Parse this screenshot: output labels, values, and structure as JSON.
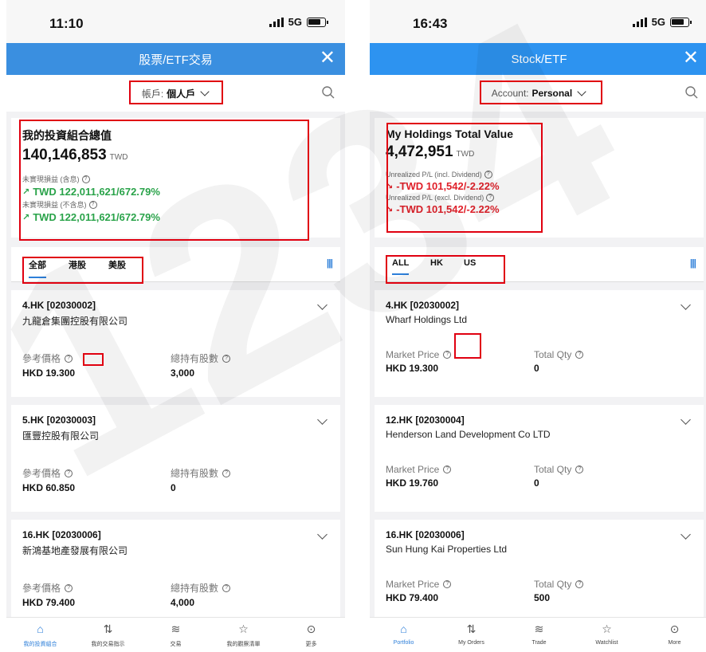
{
  "left": {
    "status": {
      "time": "11:10",
      "network": "5G"
    },
    "header": {
      "title": "股票/ETF交易",
      "close": "✕"
    },
    "account": {
      "label": "帳戶:",
      "value": "個人戶"
    },
    "summary": {
      "title": "我的投資組合總值",
      "value": "140,146,853",
      "currency": "TWD",
      "pl1_label": "未實現損益 (含息)",
      "pl1_value": "TWD 122,011,621/672.79%",
      "pl2_label": "未實現損益 (不含息)",
      "pl2_value": "TWD 122,011,621/672.79%"
    },
    "tabs": [
      "全部",
      "港股",
      "美股"
    ],
    "holdings": [
      {
        "code": "4.HK [02030002]",
        "name": "九龍倉集團控股有限公司",
        "price_label": "參考價格",
        "price": "HKD 19.300",
        "qty_label": "總持有股數",
        "qty": "3,000"
      },
      {
        "code": "5.HK [02030003]",
        "name": "匯豐控股有限公司",
        "price_label": "參考價格",
        "price": "HKD 60.850",
        "qty_label": "總持有股數",
        "qty": "0"
      },
      {
        "code": "16.HK [02030006]",
        "name": "新鴻基地產發展有限公司",
        "price_label": "參考價格",
        "price": "HKD 79.400",
        "qty_label": "總持有股數",
        "qty": "4,000"
      }
    ],
    "nav": [
      "我的投資組合",
      "我的交易指示",
      "交易",
      "我的觀察清單",
      "更多"
    ]
  },
  "right": {
    "status": {
      "time": "16:43",
      "network": "5G"
    },
    "header": {
      "title": "Stock/ETF",
      "close": "✕"
    },
    "account": {
      "label": "Account:",
      "value": "Personal"
    },
    "summary": {
      "title": "My Holdings Total Value",
      "value": "4,472,951",
      "currency": "TWD",
      "pl1_label": "Unrealized P/L (incl. Dividend)",
      "pl1_value": "-TWD 101,542/-2.22%",
      "pl2_label": "Unrealized P/L (excl. Dividend)",
      "pl2_value": "-TWD 101,542/-2.22%"
    },
    "tabs": [
      "ALL",
      "HK",
      "US"
    ],
    "holdings": [
      {
        "code": "4.HK [02030002]",
        "name": "Wharf Holdings Ltd",
        "price_label": "Market Price",
        "price": "HKD 19.300",
        "qty_label": "Total Qty",
        "qty": "0"
      },
      {
        "code": "12.HK [02030004]",
        "name": "Henderson Land Development Co LTD",
        "price_label": "Market Price",
        "price": "HKD 19.760",
        "qty_label": "Total Qty",
        "qty": "0"
      },
      {
        "code": "16.HK [02030006]",
        "name": "Sun Hung Kai Properties Ltd",
        "price_label": "Market Price",
        "price": "HKD 79.400",
        "qty_label": "Total Qty",
        "qty": "500"
      }
    ],
    "nav": [
      "Portfolio",
      "My Orders",
      "Trade",
      "Watchlist",
      "More"
    ]
  },
  "watermark": "1234",
  "colors": {
    "header_blue": "#3a8fe0",
    "accent": "#2d7fd9",
    "gain": "#2aa34a",
    "loss": "#e0202a",
    "highlight": "#e00010"
  }
}
